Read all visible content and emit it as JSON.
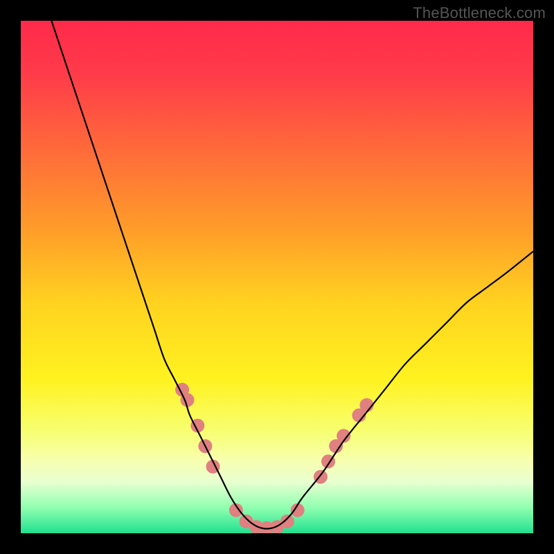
{
  "watermark": "TheBottleneck.com",
  "chart_data": {
    "type": "line",
    "title": "",
    "xlabel": "",
    "ylabel": "",
    "xlim": [
      0,
      100
    ],
    "ylim": [
      0,
      100
    ],
    "grid": false,
    "legend": false,
    "background_gradient": {
      "stops": [
        {
          "offset": 0.0,
          "color": "#ff2a4a"
        },
        {
          "offset": 0.1,
          "color": "#ff3a4a"
        },
        {
          "offset": 0.25,
          "color": "#ff6a3a"
        },
        {
          "offset": 0.4,
          "color": "#ff9a2a"
        },
        {
          "offset": 0.55,
          "color": "#ffd220"
        },
        {
          "offset": 0.7,
          "color": "#fff220"
        },
        {
          "offset": 0.8,
          "color": "#f7ff70"
        },
        {
          "offset": 0.86,
          "color": "#f7ffb0"
        },
        {
          "offset": 0.9,
          "color": "#e8ffd0"
        },
        {
          "offset": 0.95,
          "color": "#90ffb0"
        },
        {
          "offset": 1.0,
          "color": "#20e090"
        }
      ]
    },
    "series": [
      {
        "name": "bottleneck-curve",
        "color": "#000000",
        "x": [
          6,
          8,
          10,
          12,
          14,
          16,
          18,
          20,
          22,
          24,
          26,
          28,
          30,
          32,
          33,
          35,
          37,
          39,
          41,
          43,
          45,
          47,
          49,
          51,
          53,
          55,
          59,
          63,
          67,
          71,
          75,
          79,
          83,
          87,
          91,
          95,
          100
        ],
        "y": [
          100,
          94,
          88,
          82,
          76,
          70,
          64,
          58,
          52,
          46,
          40,
          34,
          30,
          26,
          23,
          19,
          15,
          11,
          7,
          4,
          2,
          1,
          1,
          2,
          4,
          7,
          12,
          18,
          23,
          28,
          33,
          37,
          41,
          45,
          48,
          51,
          55
        ]
      }
    ],
    "markers": {
      "name": "highlight-dots",
      "color": "#e08080",
      "radius": 10,
      "points": [
        {
          "x": 31.5,
          "y": 28
        },
        {
          "x": 32.5,
          "y": 26
        },
        {
          "x": 34.5,
          "y": 21
        },
        {
          "x": 36.0,
          "y": 17
        },
        {
          "x": 37.5,
          "y": 13
        },
        {
          "x": 42.0,
          "y": 4.5
        },
        {
          "x": 44.0,
          "y": 2.3
        },
        {
          "x": 46.0,
          "y": 1.2
        },
        {
          "x": 48.0,
          "y": 1.0
        },
        {
          "x": 50.0,
          "y": 1.2
        },
        {
          "x": 52.0,
          "y": 2.3
        },
        {
          "x": 54.0,
          "y": 4.5
        },
        {
          "x": 58.5,
          "y": 11
        },
        {
          "x": 60.0,
          "y": 14
        },
        {
          "x": 61.5,
          "y": 17
        },
        {
          "x": 63.0,
          "y": 19
        },
        {
          "x": 66.0,
          "y": 23
        },
        {
          "x": 67.5,
          "y": 25
        }
      ]
    }
  }
}
